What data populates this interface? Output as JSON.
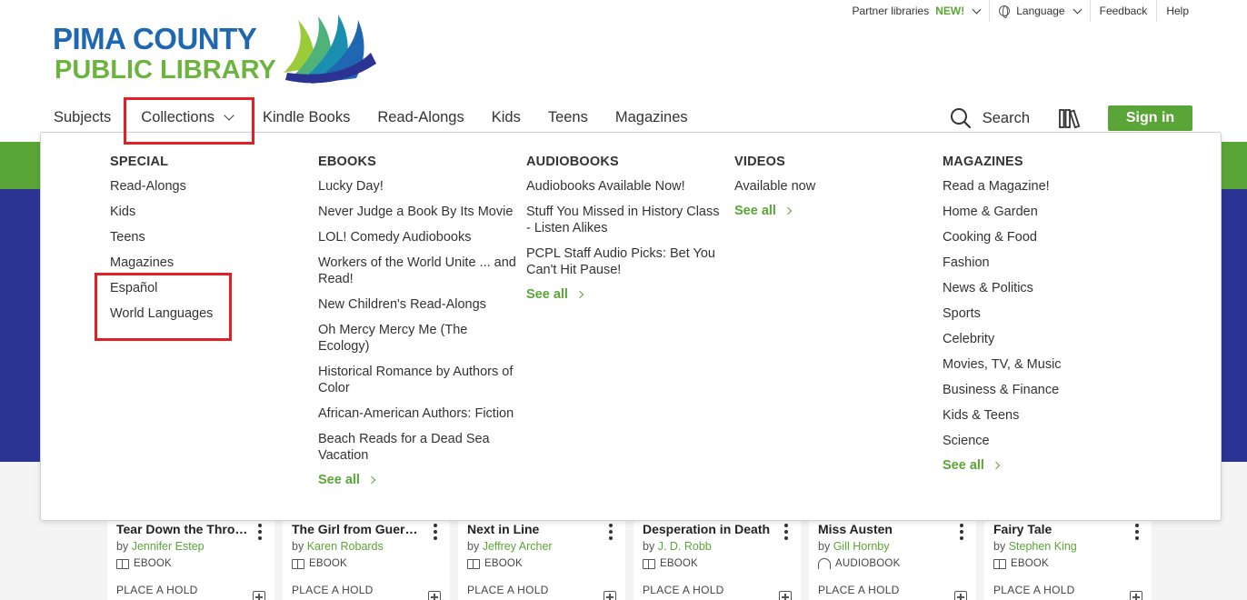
{
  "utility": {
    "partner_label": "Partner libraries",
    "partner_new": "NEW!",
    "language": "Language",
    "feedback": "Feedback",
    "help": "Help"
  },
  "logo": {
    "line1": "PIMA COUNTY",
    "line2": "PUBLIC LIBRARY"
  },
  "nav": {
    "items": [
      "Subjects",
      "Collections",
      "Kindle Books",
      "Read-Alongs",
      "Kids",
      "Teens",
      "Magazines"
    ],
    "search": "Search",
    "signin": "Sign in"
  },
  "colors": {
    "brand_green": "#5aa538",
    "brand_blue": "#2b3493",
    "logo_blue": "#1f67b1",
    "highlight_red": "#e01f26"
  },
  "dropdown": {
    "special": {
      "heading": "SPECIAL",
      "items": [
        "Read-Alongs",
        "Kids",
        "Teens",
        "Magazines",
        "Español",
        "World Languages"
      ]
    },
    "ebooks": {
      "heading": "EBOOKS",
      "items": [
        "Lucky Day!",
        "Never Judge a Book By Its Movie",
        "LOL! Comedy Audiobooks",
        "Workers of the World Unite ... and Read!",
        "New Children's Read-Alongs",
        "Oh Mercy Mercy Me (The Ecology)",
        "Historical Romance by Authors of Color",
        "African-American Authors: Fiction",
        "Beach Reads for a Dead Sea Vacation"
      ],
      "see_all": "See all"
    },
    "audiobooks": {
      "heading": "AUDIOBOOKS",
      "items": [
        "Audiobooks Available Now!",
        "Stuff You Missed in History Class - Listen Alikes",
        "PCPL Staff Audio Picks: Bet You Can't Hit Pause!"
      ],
      "see_all": "See all"
    },
    "videos": {
      "heading": "VIDEOS",
      "items": [
        "Available now"
      ],
      "see_all": "See all"
    },
    "magazines": {
      "heading": "MAGAZINES",
      "items": [
        "Read a Magazine!",
        "Home & Garden",
        "Cooking & Food",
        "Fashion",
        "News & Politics",
        "Sports",
        "Celebrity",
        "Movies, TV, & Music",
        "Business & Finance",
        "Kids & Teens",
        "Science"
      ],
      "see_all": "See all"
    }
  },
  "cards": {
    "by": "by",
    "hold": "PLACE A HOLD",
    "items": [
      {
        "title": "Tear Down the Throne",
        "author": "Jennifer Estep",
        "format": "EBOOK"
      },
      {
        "title": "The Girl from Guernica",
        "author": "Karen Robards",
        "format": "EBOOK"
      },
      {
        "title": "Next in Line",
        "author": "Jeffrey Archer",
        "format": "EBOOK"
      },
      {
        "title": "Desperation in Death",
        "author": "J. D. Robb",
        "format": "EBOOK"
      },
      {
        "title": "Miss Austen",
        "author": "Gill Hornby",
        "format": "AUDIOBOOK"
      },
      {
        "title": "Fairy Tale",
        "author": "Stephen King",
        "format": "EBOOK"
      }
    ]
  }
}
